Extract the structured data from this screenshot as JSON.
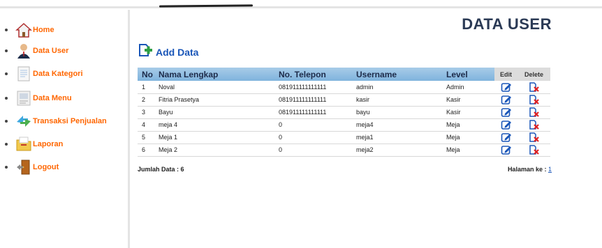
{
  "sidebar": {
    "items": [
      {
        "label": "Home",
        "icon": "home-icon"
      },
      {
        "label": "Data User",
        "icon": "user-icon"
      },
      {
        "label": "Data Kategori",
        "icon": "document-icon"
      },
      {
        "label": "Data Menu",
        "icon": "menu-card-icon"
      },
      {
        "label": "Transaksi Penjualan",
        "icon": "transaction-arrows-icon"
      },
      {
        "label": "Laporan",
        "icon": "folder-icon"
      },
      {
        "label": "Logout",
        "icon": "door-exit-icon"
      }
    ]
  },
  "main": {
    "title": "DATA USER",
    "add_label": "Add Data",
    "columns": [
      "No",
      "Nama Lengkap",
      "No. Telepon",
      "Username",
      "Level",
      "Edit",
      "Delete"
    ],
    "rows": [
      {
        "no": "1",
        "nama": "Noval",
        "telp": "081911111111111",
        "username": "admin",
        "level": "Admin"
      },
      {
        "no": "2",
        "nama": "Fitria Prasetya",
        "telp": "081911111111111",
        "username": "kasir",
        "level": "Kasir"
      },
      {
        "no": "3",
        "nama": "Bayu",
        "telp": "081911111111111",
        "username": "bayu",
        "level": "Kasir"
      },
      {
        "no": "4",
        "nama": "meja 4",
        "telp": "0",
        "username": "meja4",
        "level": "Meja"
      },
      {
        "no": "5",
        "nama": "Meja 1",
        "telp": "0",
        "username": "meja1",
        "level": "Meja"
      },
      {
        "no": "6",
        "nama": "Meja 2",
        "telp": "0",
        "username": "meja2",
        "level": "Meja"
      }
    ],
    "jumlah_label": "Jumlah Data : 6",
    "halaman_label": "Halaman ke :",
    "halaman_page": "1"
  },
  "colors": {
    "accent_orange": "#ff6600",
    "title_navy": "#2b3a55",
    "link_blue": "#1a56b8",
    "header_blue": "#7fb3dd"
  }
}
